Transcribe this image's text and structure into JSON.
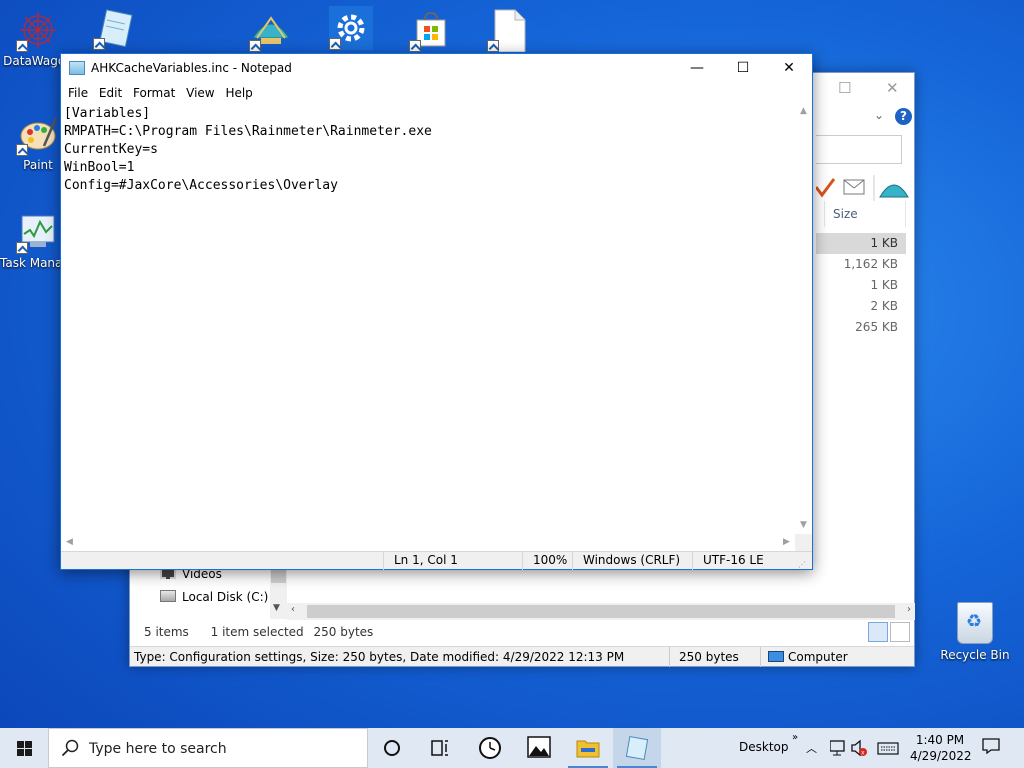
{
  "desktop": {
    "icons": [
      {
        "label": "DataWagon"
      },
      {
        "label": "Paint"
      },
      {
        "label": "Task Manager"
      }
    ],
    "recycle_bin_label": "Recycle Bin"
  },
  "explorer": {
    "size_header": "Size",
    "sizes": [
      "1 KB",
      "1,162 KB",
      "1 KB",
      "2 KB",
      "265 KB"
    ],
    "nav_items": [
      "Videos",
      "Local Disk (C:)"
    ],
    "status": {
      "items": "5 items",
      "selected": "1 item selected",
      "bytes": "250 bytes"
    },
    "details_bar": {
      "info": "Type: Configuration settings, Size: 250 bytes, Date modified: 4/29/2022 12:13 PM",
      "size": "250 bytes",
      "location": "Computer"
    }
  },
  "notepad": {
    "title": "AHKCacheVariables.inc - Notepad",
    "menu": [
      "File",
      "Edit",
      "Format",
      "View",
      "Help"
    ],
    "content": "[Variables]\nRMPATH=C:\\Program Files\\Rainmeter\\Rainmeter.exe\nCurrentKey=s\nWinBool=1\nConfig=#JaxCore\\Accessories\\Overlay",
    "status": {
      "position": "Ln 1, Col 1",
      "zoom": "100%",
      "line_ending": "Windows (CRLF)",
      "encoding": "UTF-16 LE"
    }
  },
  "taskbar": {
    "search_placeholder": "Type here to search",
    "desktop_label": "Desktop",
    "time": "1:40 PM",
    "date": "4/29/2022"
  },
  "colors": {
    "accent": "#1a6fd8",
    "taskbar_bg": "#dfe8f3",
    "desktop_bg": "#1565d8"
  }
}
